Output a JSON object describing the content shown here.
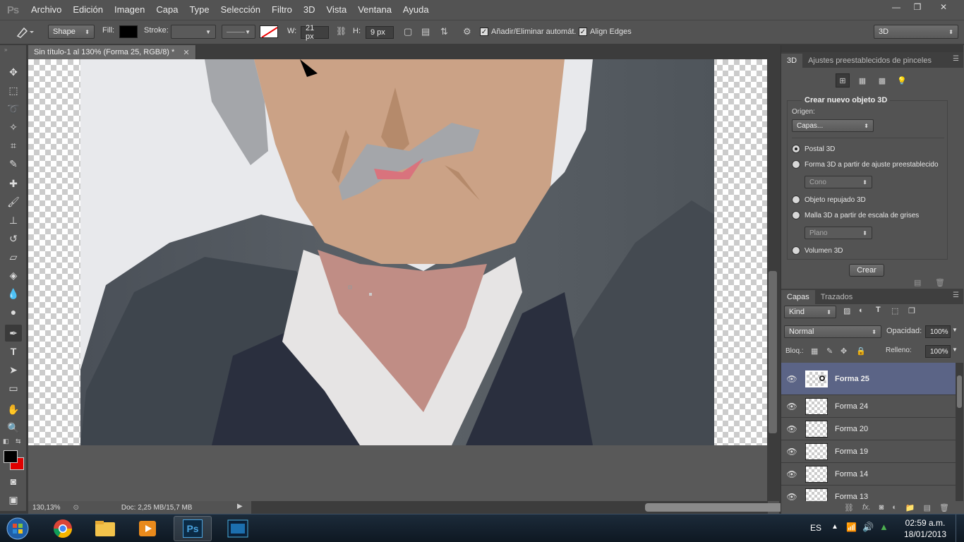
{
  "app": {
    "logo": "Ps"
  },
  "menu": [
    "Archivo",
    "Edición",
    "Imagen",
    "Capa",
    "Type",
    "Selección",
    "Filtro",
    "3D",
    "Vista",
    "Ventana",
    "Ayuda"
  ],
  "window_buttons": {
    "minimize": "—",
    "restore": "❒",
    "close": "✕"
  },
  "options": {
    "mode": "Shape",
    "fill_label": "Fill:",
    "stroke_label": "Stroke:",
    "w_label": "W:",
    "w_value": "21 px",
    "h_label": "H:",
    "h_value": "9 px",
    "auto_add_label": "Añadir/Eliminar automát.",
    "align_edges_label": "Align Edges",
    "workspace": "3D",
    "fill_color": "#000000"
  },
  "document": {
    "tab_title": "Sin título-1 al 130% (Forma 25, RGB/8) *",
    "zoom": "130,13%",
    "doc_size": "Doc: 2,25 MB/15,7 MB"
  },
  "panel3d": {
    "tabs": [
      "3D",
      "Ajustes preestablecidos de pinceles"
    ],
    "title": "Crear nuevo objeto 3D",
    "origin_label": "Origen:",
    "origin_value": "Capas...",
    "options": [
      "Postal 3D",
      "Forma 3D a partir de ajuste preestablecido",
      "Objeto repujado 3D",
      "Malla 3D a partir de escala de grises",
      "Volumen 3D"
    ],
    "preset_shape": "Cono",
    "grayscale_mesh": "Plano",
    "create_button": "Crear"
  },
  "layers": {
    "tabs": [
      "Capas",
      "Trazados"
    ],
    "kind": "Kind",
    "blend": "Normal",
    "opacity_label": "Opacidad:",
    "opacity": "100%",
    "lock_label": "Bloq.:",
    "fill_label": "Relleno:",
    "fill": "100%",
    "items": [
      "Forma 25",
      "Forma 24",
      "Forma 20",
      "Forma 19",
      "Forma 14",
      "Forma 13"
    ]
  },
  "colors": {
    "foreground": "#000000",
    "background": "#e00000",
    "selection": "#5b6486"
  },
  "taskbar": {
    "lang": "ES",
    "time": "02:59 a.m.",
    "date": "18/01/2013"
  }
}
